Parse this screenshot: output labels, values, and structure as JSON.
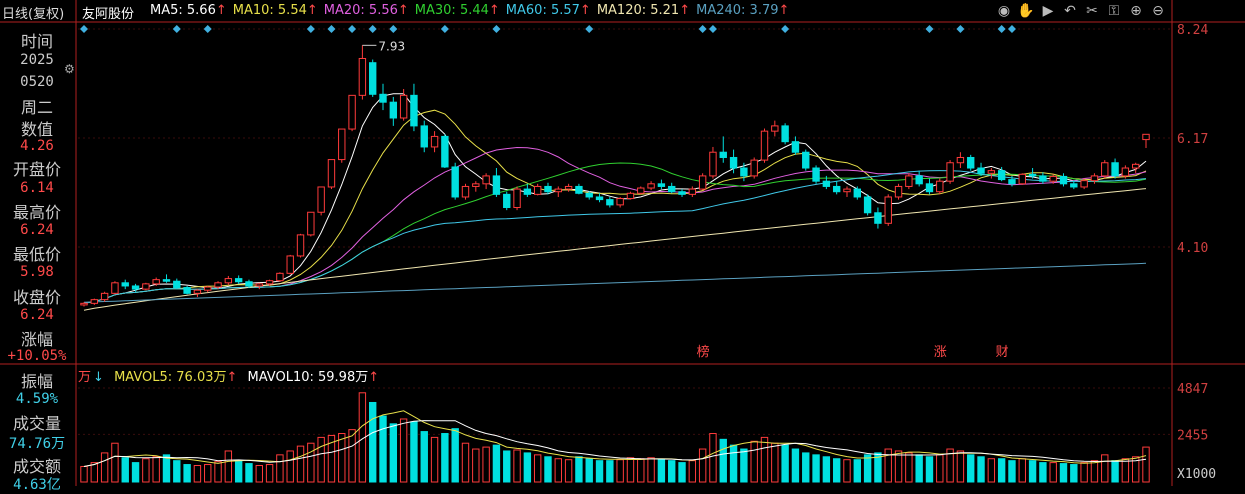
{
  "header": {
    "period_label": "日线(复权)",
    "stock_name": "友阿股份",
    "ma": [
      {
        "label": "MA5: 5.66",
        "arrow": "↑",
        "color": "#ffffff"
      },
      {
        "label": "MA10: 5.54",
        "arrow": "↑",
        "color": "#e8e04a"
      },
      {
        "label": "MA20: 5.56",
        "arrow": "↑",
        "color": "#e060e0"
      },
      {
        "label": "MA30: 5.44",
        "arrow": "↑",
        "color": "#30d030"
      },
      {
        "label": "MA60: 5.57",
        "arrow": "↑",
        "color": "#40c8e8"
      },
      {
        "label": "MA120: 5.21",
        "arrow": "↑",
        "color": "#f0e6b0"
      },
      {
        "label": "MA240: 3.79",
        "arrow": "↑",
        "color": "#5aa0c0"
      }
    ],
    "tool_icons": [
      "eye-icon",
      "hand-icon",
      "play-icon",
      "undo-icon",
      "scissors-icon",
      "lock-icon",
      "zoom-in-icon",
      "zoom-out-icon"
    ]
  },
  "side": {
    "time_label": "时间",
    "year": "2025",
    "date": "0520",
    "weekday": "周二",
    "value_label": "数值",
    "value": "4.26",
    "open_label": "开盘价",
    "open": "6.14",
    "high_label": "最高价",
    "high": "6.24",
    "low_label": "最低价",
    "low": "5.98",
    "close_label": "收盘价",
    "close": "6.24",
    "change_label": "涨幅",
    "change": "+10.05%",
    "amplitude_label": "振幅",
    "amplitude": "4.59%",
    "volume_label": "成交量",
    "volume": "74.76万",
    "turnover_label": "成交额",
    "turnover": "4.63亿"
  },
  "volume_header": {
    "unit": "万",
    "unit_arrow": "↓",
    "mavol5": "MAVOL5: 76.03万",
    "mavol5_arrow": "↑",
    "mavol10": "MAVOL10: 59.98万",
    "mavol10_arrow": "↑"
  },
  "colors": {
    "up": "#ff3b3b",
    "down": "#00e0e0",
    "axis": "#b02020"
  },
  "chart_data": {
    "type": "candlestick",
    "price_axis": {
      "ticks": [
        8.24,
        6.17,
        4.1
      ]
    },
    "volume_axis": {
      "ticks": [
        4847,
        2455
      ],
      "unit": "X1000"
    },
    "peak_annotation": "7.93",
    "event_markers": [
      {
        "label": "榜",
        "index": 60
      },
      {
        "label": "涨",
        "index": 83
      },
      {
        "label": "财",
        "index": 89
      }
    ],
    "candles": [
      [
        3.0,
        3.05,
        2.97,
        3.03,
        1.6
      ],
      [
        3.03,
        3.12,
        3.0,
        3.1,
        2.0
      ],
      [
        3.1,
        3.25,
        3.06,
        3.22,
        3.0
      ],
      [
        3.22,
        3.45,
        3.2,
        3.42,
        4.0
      ],
      [
        3.42,
        3.48,
        3.3,
        3.36,
        2.5
      ],
      [
        3.36,
        3.4,
        3.25,
        3.3,
        2.0
      ],
      [
        3.3,
        3.42,
        3.28,
        3.4,
        2.4
      ],
      [
        3.4,
        3.52,
        3.36,
        3.48,
        2.6
      ],
      [
        3.48,
        3.58,
        3.42,
        3.45,
        2.8
      ],
      [
        3.45,
        3.5,
        3.3,
        3.33,
        2.2
      ],
      [
        3.33,
        3.36,
        3.2,
        3.22,
        1.8
      ],
      [
        3.22,
        3.3,
        3.15,
        3.28,
        1.7
      ],
      [
        3.28,
        3.36,
        3.24,
        3.34,
        1.8
      ],
      [
        3.34,
        3.45,
        3.3,
        3.42,
        2.1
      ],
      [
        3.42,
        3.55,
        3.38,
        3.5,
        3.2
      ],
      [
        3.5,
        3.56,
        3.4,
        3.44,
        2.2
      ],
      [
        3.44,
        3.48,
        3.32,
        3.36,
        1.9
      ],
      [
        3.36,
        3.42,
        3.3,
        3.4,
        1.7
      ],
      [
        3.4,
        3.48,
        3.36,
        3.46,
        1.8
      ],
      [
        3.46,
        3.62,
        3.44,
        3.6,
        2.8
      ],
      [
        3.6,
        3.95,
        3.58,
        3.93,
        3.2
      ],
      [
        3.93,
        4.35,
        3.9,
        4.33,
        3.7
      ],
      [
        4.33,
        4.76,
        4.3,
        4.76,
        4.0
      ],
      [
        4.76,
        5.24,
        4.7,
        5.24,
        4.6
      ],
      [
        5.24,
        5.76,
        5.2,
        5.76,
        4.8
      ],
      [
        5.76,
        6.34,
        5.7,
        6.34,
        5.0
      ],
      [
        6.34,
        6.98,
        6.3,
        6.98,
        5.4
      ],
      [
        6.98,
        7.93,
        6.9,
        7.68,
        9.2
      ],
      [
        7.6,
        7.66,
        6.95,
        7.0,
        8.2
      ],
      [
        7.0,
        7.2,
        6.7,
        6.85,
        6.8
      ],
      [
        6.85,
        6.95,
        6.4,
        6.55,
        6.0
      ],
      [
        6.55,
        7.1,
        6.5,
        6.98,
        6.5
      ],
      [
        6.98,
        7.2,
        6.3,
        6.4,
        6.2
      ],
      [
        6.4,
        6.5,
        5.9,
        6.0,
        5.2
      ],
      [
        6.0,
        6.3,
        5.9,
        6.2,
        4.6
      ],
      [
        6.2,
        6.24,
        5.6,
        5.62,
        5.0
      ],
      [
        5.62,
        5.7,
        5.0,
        5.05,
        5.5
      ],
      [
        5.05,
        5.3,
        5.0,
        5.25,
        4.0
      ],
      [
        5.25,
        5.35,
        5.15,
        5.3,
        3.4
      ],
      [
        5.3,
        5.5,
        5.2,
        5.45,
        3.6
      ],
      [
        5.45,
        5.6,
        5.05,
        5.1,
        3.8
      ],
      [
        5.1,
        5.15,
        4.8,
        4.85,
        3.2
      ],
      [
        4.85,
        5.25,
        4.8,
        5.2,
        3.3
      ],
      [
        5.2,
        5.3,
        5.05,
        5.1,
        3.0
      ],
      [
        5.1,
        5.3,
        5.08,
        5.25,
        2.8
      ],
      [
        5.25,
        5.32,
        5.1,
        5.15,
        2.6
      ],
      [
        5.15,
        5.25,
        5.05,
        5.2,
        2.4
      ],
      [
        5.2,
        5.3,
        5.15,
        5.25,
        2.3
      ],
      [
        5.25,
        5.3,
        5.1,
        5.12,
        2.6
      ],
      [
        5.12,
        5.16,
        5.0,
        5.05,
        2.4
      ],
      [
        5.05,
        5.12,
        4.95,
        5.0,
        2.2
      ],
      [
        5.0,
        5.05,
        4.85,
        4.9,
        2.2
      ],
      [
        4.9,
        5.05,
        4.85,
        5.02,
        2.3
      ],
      [
        5.02,
        5.15,
        5.0,
        5.12,
        2.5
      ],
      [
        5.12,
        5.25,
        5.1,
        5.22,
        2.4
      ],
      [
        5.22,
        5.35,
        5.18,
        5.3,
        2.5
      ],
      [
        5.3,
        5.38,
        5.2,
        5.25,
        2.3
      ],
      [
        5.25,
        5.32,
        5.12,
        5.15,
        2.2
      ],
      [
        5.15,
        5.2,
        5.05,
        5.1,
        2.0
      ],
      [
        5.1,
        5.25,
        5.05,
        5.2,
        2.2
      ],
      [
        5.2,
        5.5,
        5.18,
        5.45,
        3.4
      ],
      [
        5.45,
        6.0,
        5.4,
        5.9,
        5.0
      ],
      [
        5.9,
        6.2,
        5.7,
        5.8,
        4.4
      ],
      [
        5.8,
        5.95,
        5.5,
        5.6,
        3.8
      ],
      [
        5.6,
        5.7,
        5.35,
        5.45,
        3.4
      ],
      [
        5.45,
        5.8,
        5.4,
        5.75,
        4.2
      ],
      [
        5.75,
        6.35,
        5.7,
        6.3,
        4.6
      ],
      [
        6.3,
        6.5,
        6.2,
        6.4,
        4.0
      ],
      [
        6.4,
        6.45,
        6.05,
        6.1,
        3.8
      ],
      [
        6.1,
        6.2,
        5.85,
        5.9,
        3.4
      ],
      [
        5.9,
        5.95,
        5.55,
        5.6,
        3.0
      ],
      [
        5.6,
        5.65,
        5.3,
        5.35,
        2.8
      ],
      [
        5.35,
        5.45,
        5.2,
        5.25,
        2.6
      ],
      [
        5.25,
        5.35,
        5.1,
        5.15,
        2.4
      ],
      [
        5.15,
        5.25,
        5.05,
        5.2,
        2.3
      ],
      [
        5.2,
        5.25,
        5.0,
        5.05,
        2.3
      ],
      [
        5.05,
        5.1,
        4.7,
        4.75,
        2.8
      ],
      [
        4.75,
        4.85,
        4.45,
        4.55,
        3.0
      ],
      [
        4.55,
        5.1,
        4.5,
        5.05,
        3.4
      ],
      [
        5.05,
        5.3,
        5.0,
        5.25,
        3.2
      ],
      [
        5.25,
        5.5,
        5.2,
        5.45,
        3.0
      ],
      [
        5.45,
        5.55,
        5.25,
        5.3,
        2.8
      ],
      [
        5.3,
        5.4,
        5.1,
        5.15,
        2.6
      ],
      [
        5.15,
        5.4,
        5.1,
        5.35,
        2.8
      ],
      [
        5.35,
        5.75,
        5.3,
        5.7,
        3.4
      ],
      [
        5.7,
        5.9,
        5.6,
        5.8,
        3.2
      ],
      [
        5.8,
        5.85,
        5.55,
        5.6,
        2.8
      ],
      [
        5.6,
        5.7,
        5.45,
        5.5,
        2.6
      ],
      [
        5.5,
        5.6,
        5.4,
        5.55,
        2.4
      ],
      [
        5.55,
        5.62,
        5.35,
        5.38,
        2.4
      ],
      [
        5.38,
        5.45,
        5.25,
        5.3,
        2.2
      ],
      [
        5.3,
        5.5,
        5.28,
        5.48,
        2.4
      ],
      [
        5.48,
        5.6,
        5.4,
        5.45,
        2.2
      ],
      [
        5.45,
        5.52,
        5.3,
        5.35,
        2.0
      ],
      [
        5.35,
        5.48,
        5.3,
        5.44,
        2.0
      ],
      [
        5.44,
        5.5,
        5.25,
        5.3,
        1.9
      ],
      [
        5.3,
        5.36,
        5.2,
        5.24,
        1.8
      ],
      [
        5.24,
        5.4,
        5.2,
        5.36,
        2.0
      ],
      [
        5.36,
        5.5,
        5.3,
        5.45,
        2.2
      ],
      [
        5.45,
        5.75,
        5.4,
        5.7,
        2.8
      ],
      [
        5.7,
        5.78,
        5.4,
        5.45,
        2.2
      ],
      [
        5.45,
        5.65,
        5.4,
        5.6,
        2.4
      ],
      [
        5.6,
        5.7,
        5.5,
        5.67,
        2.6
      ],
      [
        6.14,
        6.24,
        5.98,
        6.24,
        3.6
      ]
    ]
  }
}
